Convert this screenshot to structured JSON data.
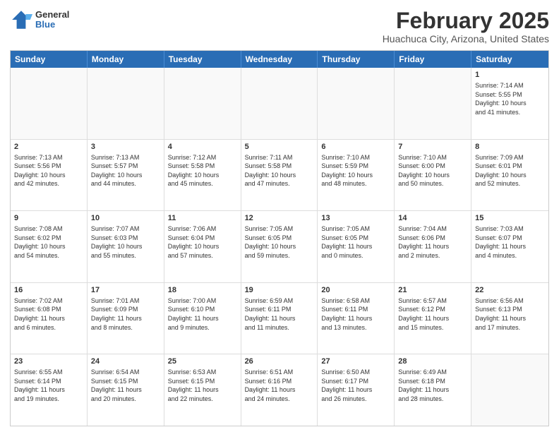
{
  "header": {
    "logo_general": "General",
    "logo_blue": "Blue",
    "month": "February 2025",
    "location": "Huachuca City, Arizona, United States"
  },
  "weekdays": [
    "Sunday",
    "Monday",
    "Tuesday",
    "Wednesday",
    "Thursday",
    "Friday",
    "Saturday"
  ],
  "rows": [
    [
      {
        "day": "",
        "info": ""
      },
      {
        "day": "",
        "info": ""
      },
      {
        "day": "",
        "info": ""
      },
      {
        "day": "",
        "info": ""
      },
      {
        "day": "",
        "info": ""
      },
      {
        "day": "",
        "info": ""
      },
      {
        "day": "1",
        "info": "Sunrise: 7:14 AM\nSunset: 5:55 PM\nDaylight: 10 hours\nand 41 minutes."
      }
    ],
    [
      {
        "day": "2",
        "info": "Sunrise: 7:13 AM\nSunset: 5:56 PM\nDaylight: 10 hours\nand 42 minutes."
      },
      {
        "day": "3",
        "info": "Sunrise: 7:13 AM\nSunset: 5:57 PM\nDaylight: 10 hours\nand 44 minutes."
      },
      {
        "day": "4",
        "info": "Sunrise: 7:12 AM\nSunset: 5:58 PM\nDaylight: 10 hours\nand 45 minutes."
      },
      {
        "day": "5",
        "info": "Sunrise: 7:11 AM\nSunset: 5:58 PM\nDaylight: 10 hours\nand 47 minutes."
      },
      {
        "day": "6",
        "info": "Sunrise: 7:10 AM\nSunset: 5:59 PM\nDaylight: 10 hours\nand 48 minutes."
      },
      {
        "day": "7",
        "info": "Sunrise: 7:10 AM\nSunset: 6:00 PM\nDaylight: 10 hours\nand 50 minutes."
      },
      {
        "day": "8",
        "info": "Sunrise: 7:09 AM\nSunset: 6:01 PM\nDaylight: 10 hours\nand 52 minutes."
      }
    ],
    [
      {
        "day": "9",
        "info": "Sunrise: 7:08 AM\nSunset: 6:02 PM\nDaylight: 10 hours\nand 54 minutes."
      },
      {
        "day": "10",
        "info": "Sunrise: 7:07 AM\nSunset: 6:03 PM\nDaylight: 10 hours\nand 55 minutes."
      },
      {
        "day": "11",
        "info": "Sunrise: 7:06 AM\nSunset: 6:04 PM\nDaylight: 10 hours\nand 57 minutes."
      },
      {
        "day": "12",
        "info": "Sunrise: 7:05 AM\nSunset: 6:05 PM\nDaylight: 10 hours\nand 59 minutes."
      },
      {
        "day": "13",
        "info": "Sunrise: 7:05 AM\nSunset: 6:05 PM\nDaylight: 11 hours\nand 0 minutes."
      },
      {
        "day": "14",
        "info": "Sunrise: 7:04 AM\nSunset: 6:06 PM\nDaylight: 11 hours\nand 2 minutes."
      },
      {
        "day": "15",
        "info": "Sunrise: 7:03 AM\nSunset: 6:07 PM\nDaylight: 11 hours\nand 4 minutes."
      }
    ],
    [
      {
        "day": "16",
        "info": "Sunrise: 7:02 AM\nSunset: 6:08 PM\nDaylight: 11 hours\nand 6 minutes."
      },
      {
        "day": "17",
        "info": "Sunrise: 7:01 AM\nSunset: 6:09 PM\nDaylight: 11 hours\nand 8 minutes."
      },
      {
        "day": "18",
        "info": "Sunrise: 7:00 AM\nSunset: 6:10 PM\nDaylight: 11 hours\nand 9 minutes."
      },
      {
        "day": "19",
        "info": "Sunrise: 6:59 AM\nSunset: 6:11 PM\nDaylight: 11 hours\nand 11 minutes."
      },
      {
        "day": "20",
        "info": "Sunrise: 6:58 AM\nSunset: 6:11 PM\nDaylight: 11 hours\nand 13 minutes."
      },
      {
        "day": "21",
        "info": "Sunrise: 6:57 AM\nSunset: 6:12 PM\nDaylight: 11 hours\nand 15 minutes."
      },
      {
        "day": "22",
        "info": "Sunrise: 6:56 AM\nSunset: 6:13 PM\nDaylight: 11 hours\nand 17 minutes."
      }
    ],
    [
      {
        "day": "23",
        "info": "Sunrise: 6:55 AM\nSunset: 6:14 PM\nDaylight: 11 hours\nand 19 minutes."
      },
      {
        "day": "24",
        "info": "Sunrise: 6:54 AM\nSunset: 6:15 PM\nDaylight: 11 hours\nand 20 minutes."
      },
      {
        "day": "25",
        "info": "Sunrise: 6:53 AM\nSunset: 6:15 PM\nDaylight: 11 hours\nand 22 minutes."
      },
      {
        "day": "26",
        "info": "Sunrise: 6:51 AM\nSunset: 6:16 PM\nDaylight: 11 hours\nand 24 minutes."
      },
      {
        "day": "27",
        "info": "Sunrise: 6:50 AM\nSunset: 6:17 PM\nDaylight: 11 hours\nand 26 minutes."
      },
      {
        "day": "28",
        "info": "Sunrise: 6:49 AM\nSunset: 6:18 PM\nDaylight: 11 hours\nand 28 minutes."
      },
      {
        "day": "",
        "info": ""
      }
    ]
  ]
}
